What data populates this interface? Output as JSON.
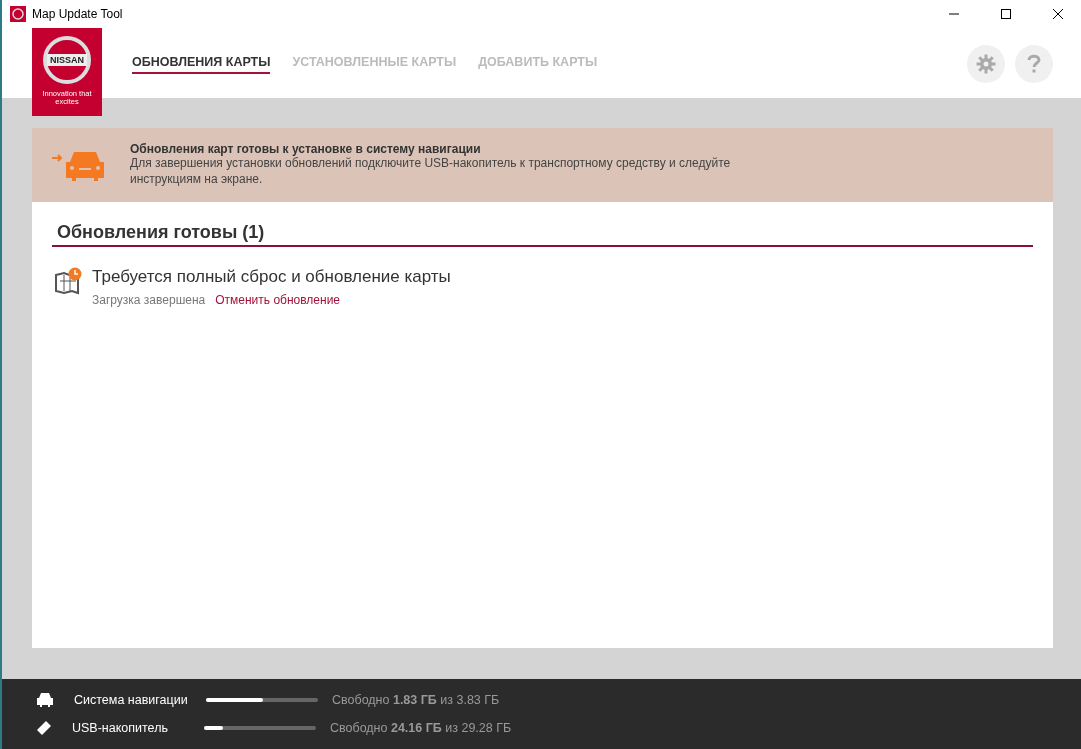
{
  "window": {
    "title": "Map Update Tool"
  },
  "logo": {
    "wordmark": "NISSAN",
    "tagline": "Innovation that excites"
  },
  "tabs": [
    {
      "label": "ОБНОВЛЕНИЯ КАРТЫ",
      "selected": true
    },
    {
      "label": "УСТАНОВЛЕННЫЕ КАРТЫ",
      "selected": false
    },
    {
      "label": "ДОБАВИТЬ КАРТЫ",
      "selected": false
    }
  ],
  "notice": {
    "title": "Обновления карт готовы к установке в систему навигации",
    "text": "Для завершения установки обновлений подключите USB-накопитель к транспортному средству и следуйте инструкциям на экране."
  },
  "section": {
    "title": "Обновления готовы (1)"
  },
  "updates": [
    {
      "title": "Требуется полный сброс и обновление карты",
      "status": "Загрузка завершена",
      "action": "Отменить обновление"
    }
  ],
  "storage": [
    {
      "kind": "car",
      "name": "Система навигации",
      "level": 0.51,
      "free": "Свободно **1.83 ГБ** из 3.83 ГБ"
    },
    {
      "kind": "usb",
      "name": "USB-накопитель",
      "level": 0.17,
      "free": "Свободно **24.16 ГБ** из 29.28 ГБ"
    }
  ]
}
